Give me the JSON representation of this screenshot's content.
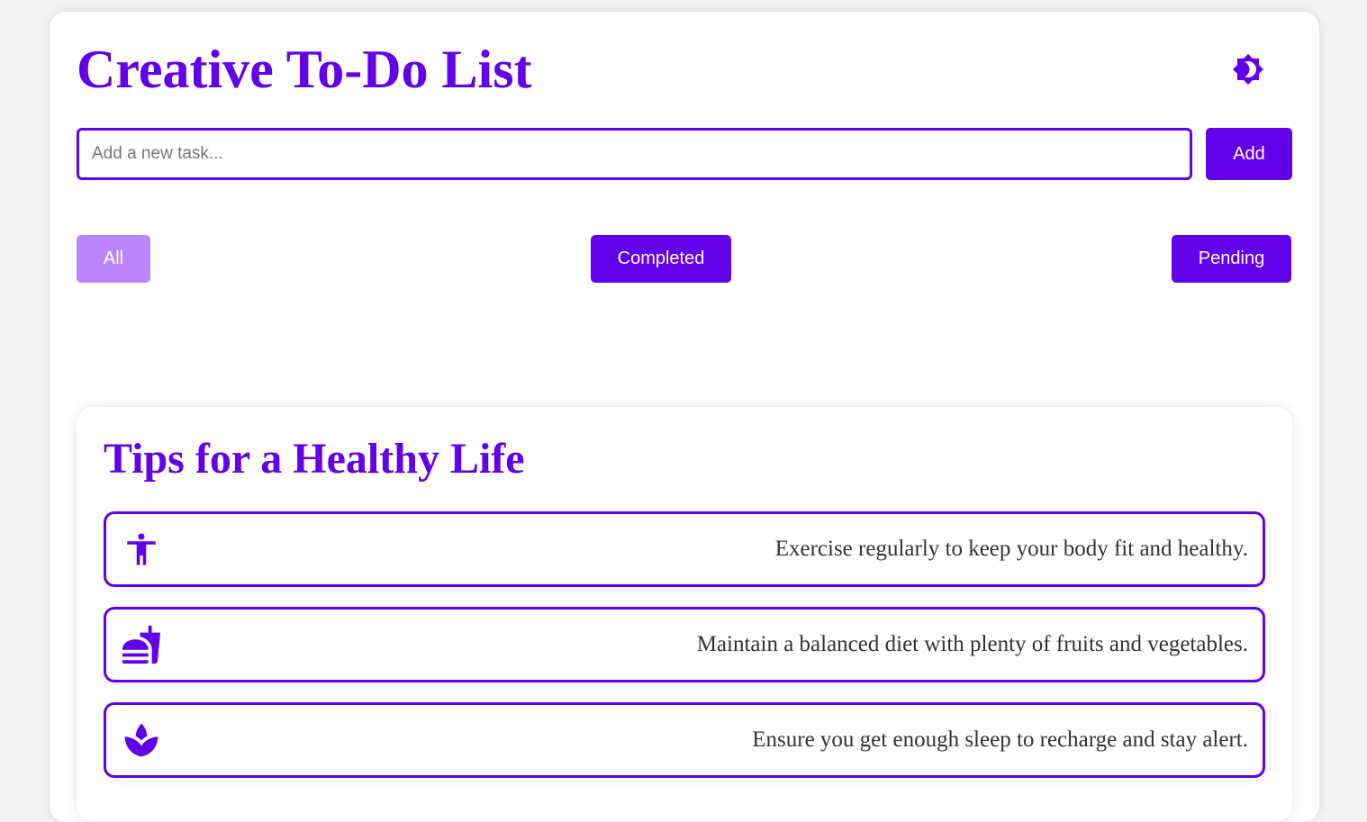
{
  "app": {
    "title": "Creative To-Do List",
    "theme_toggle_icon": "brightness-icon"
  },
  "task_entry": {
    "placeholder": "Add a new task...",
    "value": "",
    "add_label": "Add"
  },
  "filters": {
    "active": "All",
    "all_label": "All",
    "completed_label": "Completed",
    "pending_label": "Pending"
  },
  "tasks": [],
  "tips": {
    "title": "Tips for a Healthy Life",
    "items": [
      {
        "icon": "accessibility-icon",
        "text": "Exercise regularly to keep your body fit and healthy."
      },
      {
        "icon": "fastfood-icon",
        "text": "Maintain a balanced diet with plenty of fruits and vegetables."
      },
      {
        "icon": "spa-icon",
        "text": "Ensure you get enough sleep to recharge and stay alert."
      }
    ]
  },
  "colors": {
    "accent": "#6200ea",
    "accent_light": "#bb86fc",
    "background": "#f4f4f4",
    "card": "#ffffff",
    "text": "#333333"
  }
}
